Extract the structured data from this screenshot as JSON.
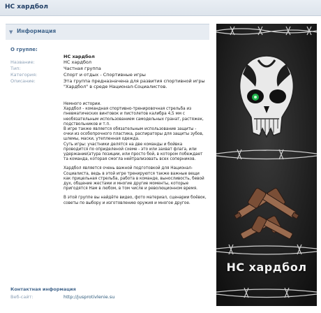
{
  "header": {
    "title": "НС хардбол"
  },
  "info": {
    "section_label": "Информация"
  },
  "group": {
    "heading": "О группе:",
    "fields": [
      {
        "key": "",
        "value": "НС хардбол"
      },
      {
        "key": "Название:",
        "value": "НС хардбол"
      },
      {
        "key": "Тип:",
        "value": "Частная группа"
      },
      {
        "key": "Категория:",
        "value": "Спорт и отдых - Спортивные игры"
      },
      {
        "key": "Описание:",
        "value": "Эта группа предназначена для развития спортивной игры \"Хардбол\" в среде Национал-Социалистов."
      }
    ],
    "title_value": "НС хардбол",
    "type_key": "Тип:",
    "category_key": "Категория:",
    "desc_key": "Описание:",
    "name_key": "Название:",
    "type_value": "Частная группа",
    "category_value": "Спорт и отдых - Спортивные игры",
    "desc_intro": "Эта группа предназначена для развития спортивной игры \"Хардбол\" в среде Национал-Социалистов."
  },
  "description": {
    "history": "Немного истории.\nХардбол - командная спортивно-тренировочная стрельба из пневматических винтовок и пистолетов калибра 4,5 мм с необязательным использованием самодельных гранат, растяжек, подствольников и т.п.\nВ игре также является обязательным использование защиты - очки из особопрочного пластика, распираторы для защиты зубов, шлемы, маски, утепленная одежда.\nСуть игры: участники делятся на две команды и бойвка проводится по оприделеной схеме - это или захват флага, или удержание(атура позиции, или просто бой, в котором побеждает та команда, которая смогла нейтрализовать всех соперников.",
    "importance": "Хардбол является очень важной подготовкой для Национал-Социалиста, ведь в этой игре тренируются также важные вещи как прицельная стрельба, работа в команде, выносливость, бевой дух, общение жестами и многие другие моменты, которые пригодятся Нам в любом, в том числе и революционном время.",
    "content": "В этой группе вы найдёте видео, фото материал, сценарии боёвок, советы по выбору и изготовлению оружия и многое другое."
  },
  "contact": {
    "heading": "Контактная информация",
    "site_key": "Веб-сайт:",
    "site_value": "http://jusprotivlenie.su"
  },
  "poster": {
    "caption": "НС хардбол"
  }
}
